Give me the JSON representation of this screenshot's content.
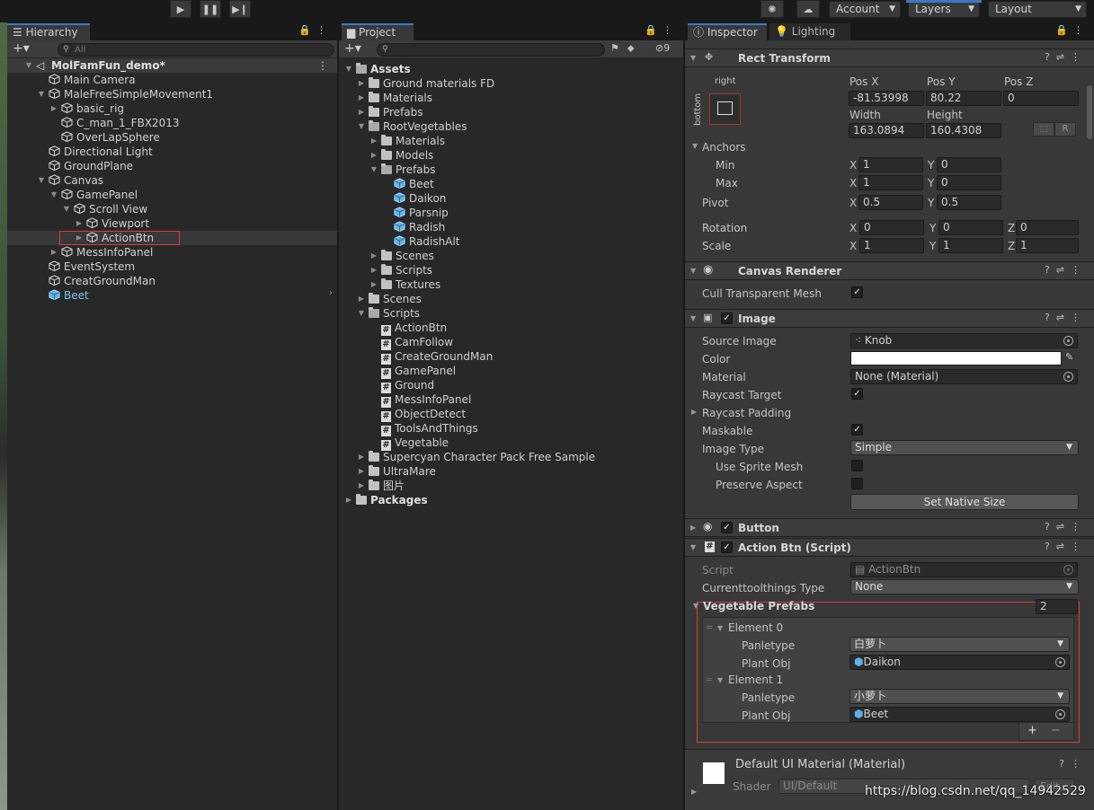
{
  "toolbar": {
    "play": "▶",
    "pause": "❚❚",
    "step": "▶❙",
    "account": "Account",
    "layers": "Layers",
    "layout": "Layout"
  },
  "hierarchy": {
    "tab": "Hierarchy",
    "search_placeholder": "All",
    "items": [
      {
        "label": "MolFamFun_demo*",
        "depth": 0,
        "expanded": true,
        "bold": true
      },
      {
        "label": "Main Camera",
        "depth": 1
      },
      {
        "label": "MaleFreeSimpleMovement1",
        "depth": 1,
        "expanded": true
      },
      {
        "label": "basic_rig",
        "depth": 2,
        "collapsed": true
      },
      {
        "label": "C_man_1_FBX2013",
        "depth": 2
      },
      {
        "label": "OverLapSphere",
        "depth": 2
      },
      {
        "label": "Directional Light",
        "depth": 1
      },
      {
        "label": "GroundPlane",
        "depth": 1
      },
      {
        "label": "Canvas",
        "depth": 1,
        "expanded": true
      },
      {
        "label": "GamePanel",
        "depth": 2,
        "expanded": true
      },
      {
        "label": "Scroll View",
        "depth": 3,
        "expanded": true
      },
      {
        "label": "Viewport",
        "depth": 4,
        "collapsed": true
      },
      {
        "label": "ActionBtn",
        "depth": 4,
        "collapsed": true,
        "selected": true
      },
      {
        "label": "MessInfoPanel",
        "depth": 2,
        "collapsed": true
      },
      {
        "label": "EventSystem",
        "depth": 1
      },
      {
        "label": "CreatGroundMan",
        "depth": 1
      },
      {
        "label": "Beet",
        "depth": 1,
        "prefab": true
      }
    ]
  },
  "project": {
    "tab": "Project",
    "hidden_count": "9",
    "items": [
      {
        "label": "Assets",
        "depth": 0,
        "expanded": true,
        "bold": true,
        "kind": "folder"
      },
      {
        "label": "Ground materials FD",
        "depth": 1,
        "kind": "folder"
      },
      {
        "label": "Materials",
        "depth": 1,
        "kind": "folder"
      },
      {
        "label": "Prefabs",
        "depth": 1,
        "kind": "folder"
      },
      {
        "label": "RootVegetables",
        "depth": 1,
        "expanded": true,
        "kind": "folder"
      },
      {
        "label": "Materials",
        "depth": 2,
        "kind": "folder"
      },
      {
        "label": "Models",
        "depth": 2,
        "kind": "folder"
      },
      {
        "label": "Prefabs",
        "depth": 2,
        "expanded": true,
        "kind": "folder"
      },
      {
        "label": "Beet",
        "depth": 3,
        "kind": "prefab"
      },
      {
        "label": "Daikon",
        "depth": 3,
        "kind": "prefab"
      },
      {
        "label": "Parsnip",
        "depth": 3,
        "kind": "prefab"
      },
      {
        "label": "Radish",
        "depth": 3,
        "kind": "prefab"
      },
      {
        "label": "RadishAlt",
        "depth": 3,
        "kind": "prefab"
      },
      {
        "label": "Scenes",
        "depth": 2,
        "kind": "folder"
      },
      {
        "label": "Scripts",
        "depth": 2,
        "kind": "folder"
      },
      {
        "label": "Textures",
        "depth": 2,
        "kind": "folder"
      },
      {
        "label": "Scenes",
        "depth": 1,
        "kind": "folder"
      },
      {
        "label": "Scripts",
        "depth": 1,
        "expanded": true,
        "kind": "folder"
      },
      {
        "label": "ActionBtn",
        "depth": 2,
        "kind": "script"
      },
      {
        "label": "CamFollow",
        "depth": 2,
        "kind": "script"
      },
      {
        "label": "CreateGroundMan",
        "depth": 2,
        "kind": "script"
      },
      {
        "label": "GamePanel",
        "depth": 2,
        "kind": "script"
      },
      {
        "label": "Ground",
        "depth": 2,
        "kind": "script"
      },
      {
        "label": "MessInfoPanel",
        "depth": 2,
        "kind": "script"
      },
      {
        "label": "ObjectDetect",
        "depth": 2,
        "kind": "script"
      },
      {
        "label": "ToolsAndThings",
        "depth": 2,
        "kind": "script"
      },
      {
        "label": "Vegetable",
        "depth": 2,
        "kind": "script"
      },
      {
        "label": "Supercyan Character Pack Free Sample",
        "depth": 1,
        "kind": "folder"
      },
      {
        "label": "UltraMare",
        "depth": 1,
        "kind": "folder"
      },
      {
        "label": "图片",
        "depth": 1,
        "kind": "folder"
      },
      {
        "label": "Packages",
        "depth": 0,
        "bold": true,
        "kind": "folder"
      }
    ]
  },
  "inspector": {
    "tabs": {
      "inspector": "Inspector",
      "lighting": "Lighting"
    },
    "rect": {
      "title": "Rect Transform",
      "anchor_top": "right",
      "anchor_side": "bottom",
      "posx_l": "Pos X",
      "posy_l": "Pos Y",
      "posz_l": "Pos Z",
      "posx": "-81.53998",
      "posy": "80.22",
      "posz": "0",
      "width_l": "Width",
      "height_l": "Height",
      "width": "163.0894",
      "height": "160.4308",
      "r_btn": "R",
      "anchors": "Anchors",
      "min": "Min",
      "max": "Max",
      "min_x": "1",
      "min_y": "0",
      "max_x": "1",
      "max_y": "0",
      "pivot": "Pivot",
      "pivot_x": "0.5",
      "pivot_y": "0.5",
      "rotation": "Rotation",
      "rot_x": "0",
      "rot_y": "0",
      "rot_z": "0",
      "scale": "Scale",
      "scale_x": "1",
      "scale_y": "1",
      "scale_z": "1",
      "X": "X",
      "Y": "Y",
      "Z": "Z"
    },
    "canvas_renderer": {
      "title": "Canvas Renderer",
      "cull": "Cull Transparent Mesh"
    },
    "image": {
      "title": "Image",
      "source_l": "Source Image",
      "source": "Knob",
      "color_l": "Color",
      "material_l": "Material",
      "material": "None (Material)",
      "raycast_l": "Raycast Target",
      "padding_l": "Raycast Padding",
      "maskable_l": "Maskable",
      "type_l": "Image Type",
      "type": "Simple",
      "sprite_mesh_l": "Use Sprite Mesh",
      "preserve_l": "Preserve Aspect",
      "native_btn": "Set Native Size",
      "color": "#ffffff"
    },
    "button": {
      "title": "Button"
    },
    "action": {
      "title": "Action Btn (Script)",
      "script_l": "Script",
      "script": "ActionBtn",
      "tool_l": "Currenttoolthings Type",
      "tool": "None",
      "veg_l": "Vegetable Prefabs",
      "veg_count": "2",
      "elements": [
        {
          "label": "Element 0",
          "panle_l": "Panletype",
          "panle": "白萝卜",
          "plant_l": "Plant Obj",
          "plant": "Daikon"
        },
        {
          "label": "Element 1",
          "panle_l": "Panletype",
          "panle": "小萝卜",
          "plant_l": "Plant Obj",
          "plant": "Beet"
        }
      ],
      "add": "+",
      "remove": "−"
    },
    "material": {
      "title": "Default UI Material (Material)",
      "shader_l": "Shader",
      "shader": "UI/Default",
      "edit": "Edit..."
    }
  },
  "watermark": "https://blog.csdn.net/qq_14942529",
  "colors": {
    "selection_outline": "#e0393e",
    "prefab_blue": "#7cc4f2",
    "accent": "#3a78c9"
  }
}
